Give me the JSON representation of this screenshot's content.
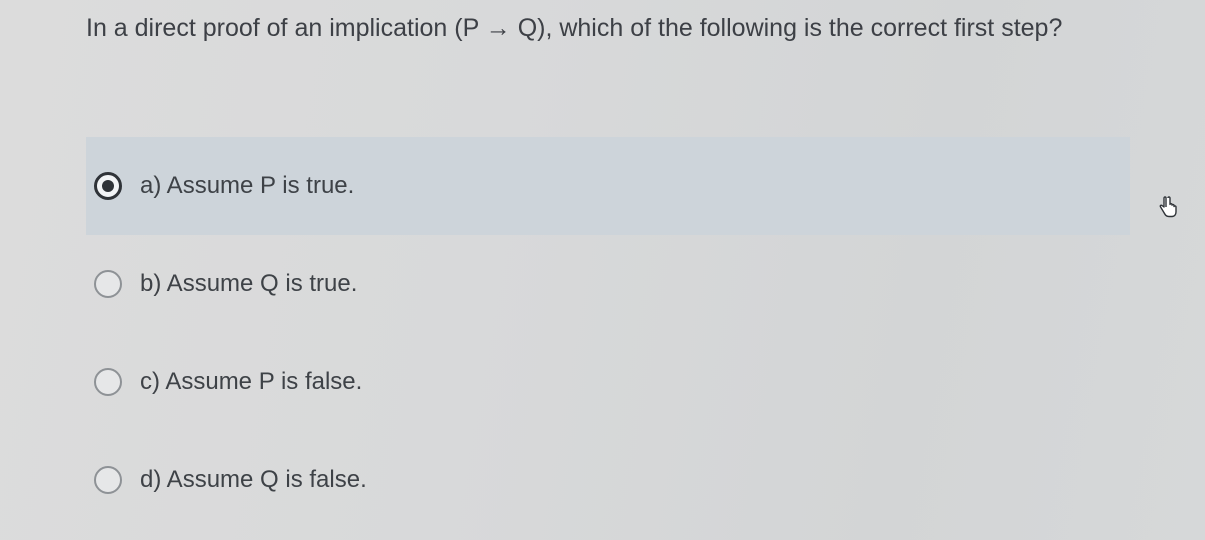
{
  "question": {
    "text": "In a direct proof of an implication (P → Q), which of the following is the correct first step?"
  },
  "options": [
    {
      "label": "a) Assume P is true.",
      "selected": true
    },
    {
      "label": "b) Assume Q is true.",
      "selected": false
    },
    {
      "label": "c) Assume P is false.",
      "selected": false
    },
    {
      "label": "d) Assume Q is false.",
      "selected": false
    }
  ],
  "cursor": {
    "icon": "hand-pointer-icon"
  },
  "colors": {
    "selected_background": "#cdd4da",
    "text": "#3e4247",
    "radio_selected": "#2f3338"
  }
}
